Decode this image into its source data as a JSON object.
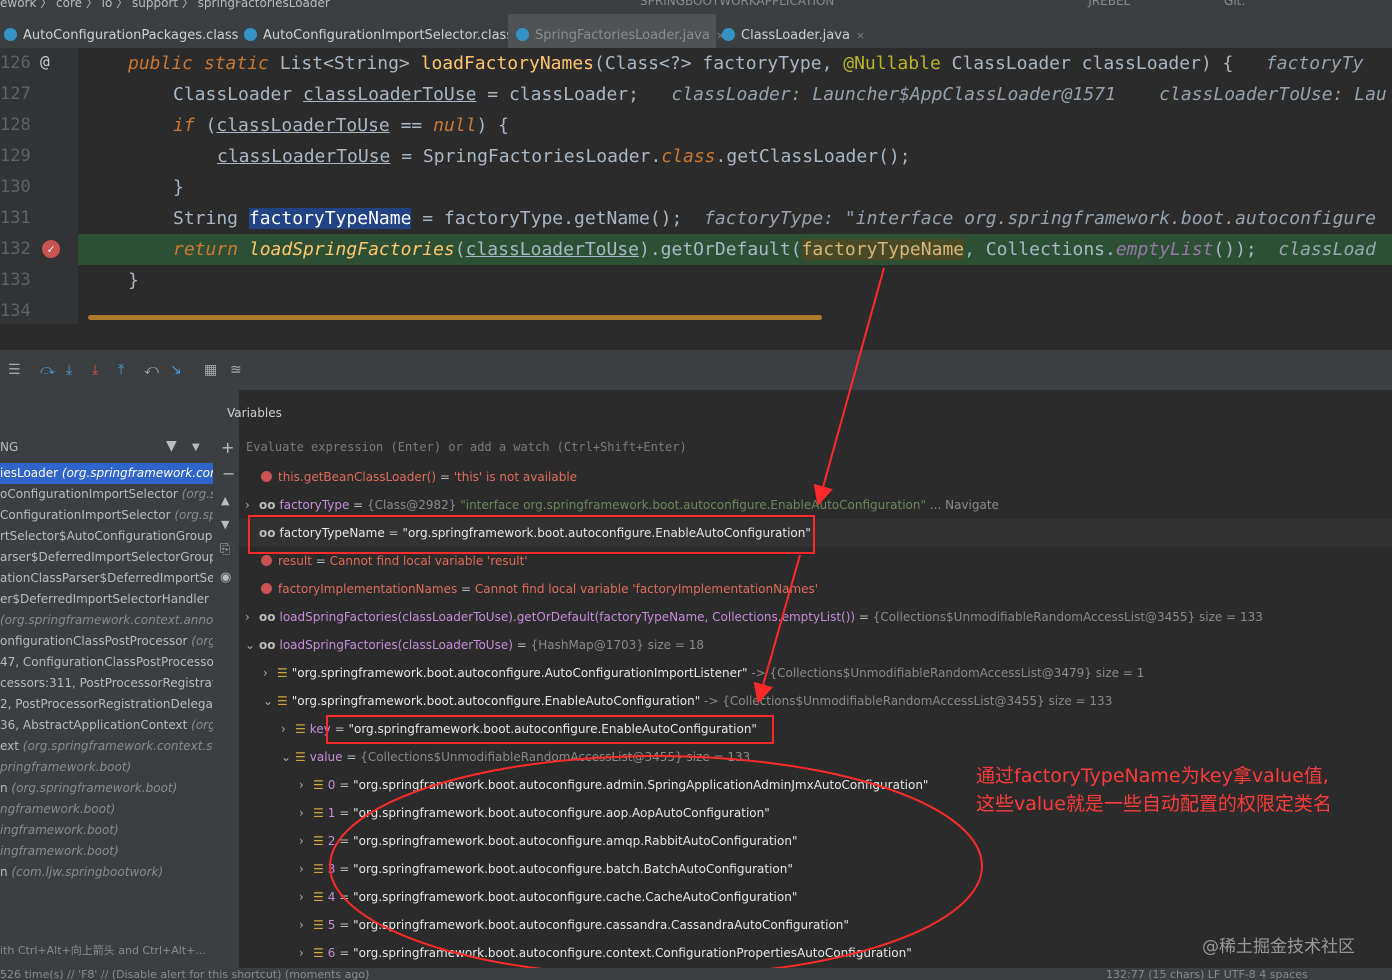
{
  "topbar": {
    "breadcrumbs": "ework  〉 core 〉 io 〉 support 〉 springFactoriesLoader",
    "run_config": "SPRINGBOOTWORKAPPLICATION",
    "plugin": "JREBEL",
    "git": "Git:"
  },
  "tabs": [
    {
      "label": "AutoConfigurationPackages.class",
      "close": "×"
    },
    {
      "label": "AutoConfigurationImportSelector.class",
      "close": "×"
    },
    {
      "label": "SpringFactoriesLoader.java",
      "close": "×"
    },
    {
      "label": "ClassLoader.java",
      "close": "×"
    }
  ],
  "editor": {
    "line_numbers": [
      "126",
      "127",
      "128",
      "129",
      "130",
      "131",
      "132",
      "133",
      "134"
    ],
    "line126": {
      "kw1": "public static ",
      "type": "List<String> ",
      "fn": "loadFactoryNames",
      "args": "(Class<?> factoryType, ",
      "ann": "@Nullable ",
      "args2": "ClassLoader classLoader) {",
      "hint": "   factoryTy"
    },
    "line127": {
      "type": "ClassLoader ",
      "var": "classLoaderToUse",
      "rest": " = classLoader;",
      "hint": "   classLoader: Launcher$AppClassLoader@1571    classLoaderToUse: Lau"
    },
    "line128": {
      "kw": "if ",
      "open": "(",
      "var": "classLoaderToUse",
      "rest": " == ",
      "null": "null",
      "close": ") {"
    },
    "line129": {
      "var": "classLoaderToUse",
      "rest": " = SpringFactoriesLoader.",
      "cls": "class",
      "rest2": ".getClassLoader();"
    },
    "line130": {
      "text": "}"
    },
    "line131": {
      "type": "String ",
      "sel": "factoryTypeName",
      "rest": " = factoryType.getName();",
      "hint": "  factoryType: \"interface org.springframework.boot.autoconfigure"
    },
    "line132": {
      "kw": "return ",
      "fn": "loadSpringFactories",
      "open": "(",
      "var": "classLoaderToUse",
      "rest": ").getOrDefault(",
      "mark": "factoryTypeName",
      "rest2": ", Collections.",
      "stat": "emptyList",
      "rest3": "());",
      "hint": "  classLoad"
    },
    "line133": {
      "text": "}"
    }
  },
  "debugger": {
    "variables_tab": "Variables",
    "threads_label": "NG",
    "expression_placeholder": "Evaluate expression (Enter) or add a watch (Ctrl+Shift+Enter)",
    "frames": [
      {
        "main": "iesLoader ",
        "pkg": "(org.springframework.cor"
      },
      {
        "main": "oConfigurationImportSelector ",
        "pkg": "(org.s"
      },
      {
        "main": "ConfigurationImportSelector ",
        "pkg": "(org.sp"
      },
      {
        "main": "rtSelector$AutoConfigurationGroup ",
        "pkg": ""
      },
      {
        "main": "arser$DeferredImportSelectorGroup",
        "pkg": ""
      },
      {
        "main": "ationClassParser$DeferredImportSele",
        "pkg": ""
      },
      {
        "main": "er$DeferredImportSelectorHandler ",
        "pkg": "(("
      },
      {
        "main": "",
        "pkg": "(org.springframework.context.annot"
      },
      {
        "main": "onfigurationClassPostProcessor ",
        "pkg": "(org"
      },
      {
        "main": "47, ConfigurationClassPostProcessor",
        "pkg": ""
      },
      {
        "main": "cessors:311, PostProcessorRegistrati",
        "pkg": ""
      },
      {
        "main": "2, PostProcessorRegistrationDelegat",
        "pkg": ""
      },
      {
        "main": "36, AbstractApplicationContext ",
        "pkg": "(org.s"
      },
      {
        "main": "ext ",
        "pkg": "(org.springframework.context.su"
      },
      {
        "main": "",
        "pkg": "pringframework.boot)"
      },
      {
        "main": "n ",
        "pkg": "(org.springframework.boot)"
      },
      {
        "main": "",
        "pkg": "ngframework.boot)"
      },
      {
        "main": "",
        "pkg": "ingframework.boot)"
      },
      {
        "main": "",
        "pkg": "ingframework.boot)"
      },
      {
        "main": "n ",
        "pkg": "(com.ljw.springbootwork)"
      }
    ],
    "frames_hint": "ith Ctrl+Alt+向上箭头 and Ctrl+Alt+...",
    "vars": {
      "v1": {
        "name": "this.getBeanClassLoader()",
        "eq": " = ",
        "val": "'this' is not available"
      },
      "v2": {
        "name": "factoryType",
        "eq": " = ",
        "meta": "{Class@2982} ",
        "val": "\"interface org.springframework.boot.autoconfigure.EnableAutoConfiguration\"",
        "link": " ... Navigate"
      },
      "v3": {
        "name": "factoryTypeName",
        "eq": " = ",
        "val": "\"org.springframework.boot.autoconfigure.EnableAutoConfiguration\""
      },
      "v4": {
        "name": "result",
        "eq": " = ",
        "val": "Cannot find local variable 'result'"
      },
      "v5": {
        "name": "factoryImplementationNames",
        "eq": " = ",
        "val": "Cannot find local variable 'factoryImplementationNames'"
      },
      "v6": {
        "name": "loadSpringFactories(classLoaderToUse).getOrDefault(factoryTypeName, Collections.emptyList())",
        "eq": " = ",
        "meta": "{Collections$UnmodifiableRandomAccessList@3455}  size = 133"
      },
      "v7": {
        "name": "loadSpringFactories(classLoaderToUse)",
        "eq": " = ",
        "meta": "{HashMap@1703}  size = 18"
      },
      "v8": {
        "name": "\"org.springframework.boot.autoconfigure.AutoConfigurationImportListener\"",
        "arrow": " -> ",
        "meta": "{Collections$UnmodifiableRandomAccessList@3479}  size = 1"
      },
      "v9": {
        "name": "\"org.springframework.boot.autoconfigure.EnableAutoConfiguration\"",
        "arrow": " -> ",
        "meta": "{Collections$UnmodifiableRandomAccessList@3455}  size = 133"
      },
      "v10": {
        "name": "key",
        "eq": " = ",
        "val": "\"org.springframework.boot.autoconfigure.EnableAutoConfiguration\""
      },
      "v11": {
        "name": "value",
        "eq": " = ",
        "meta": "{Collections$UnmodifiableRandomAccessList@3455}  size = 133"
      },
      "items": [
        {
          "idx": "0",
          "val": "\"org.springframework.boot.autoconfigure.admin.SpringApplicationAdminJmxAutoConfiguration\""
        },
        {
          "idx": "1",
          "val": "\"org.springframework.boot.autoconfigure.aop.AopAutoConfiguration\""
        },
        {
          "idx": "2",
          "val": "\"org.springframework.boot.autoconfigure.amqp.RabbitAutoConfiguration\""
        },
        {
          "idx": "3",
          "val": "\"org.springframework.boot.autoconfigure.batch.BatchAutoConfiguration\""
        },
        {
          "idx": "4",
          "val": "\"org.springframework.boot.autoconfigure.cache.CacheAutoConfiguration\""
        },
        {
          "idx": "5",
          "val": "\"org.springframework.boot.autoconfigure.cassandra.CassandraAutoConfiguration\""
        },
        {
          "idx": "6",
          "val": "\"org.springframework.boot.autoconfigure.context.ConfigurationPropertiesAutoConfiguration\""
        }
      ]
    }
  },
  "annotation": {
    "line1": "通过factoryTypeName为key拿value值,",
    "line2": "这些value就是一些自动配置的权限定类名"
  },
  "watermark": "@稀土掘金技术社区",
  "statusbar": {
    "left": "526 time(s) // 'F8' // (Disable alert for this shortcut) (moments ago)",
    "right": "132:77 (15 chars)   LF   UTF-8   4 spaces"
  },
  "colors": {
    "annotation_red": "#ff2a2a",
    "exec_line": "#2d5034",
    "selection": "#214283"
  }
}
